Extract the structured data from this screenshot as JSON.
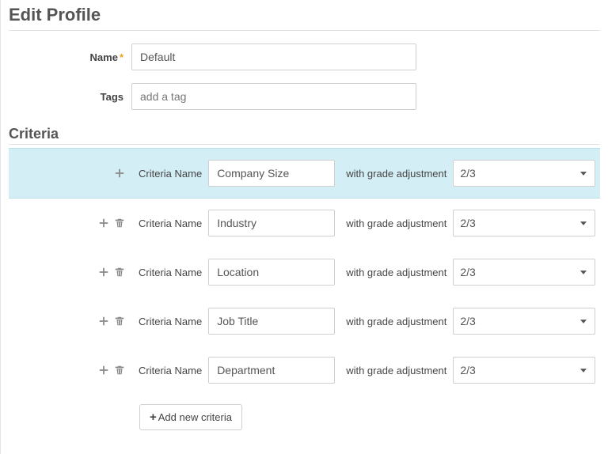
{
  "page": {
    "title": "Edit Profile",
    "criteria_section": "Criteria"
  },
  "form": {
    "name_label": "Name",
    "name_value": "Default",
    "tags_label": "Tags",
    "tags_placeholder": "add a tag"
  },
  "criteria_row": {
    "name_label": "Criteria Name",
    "grade_label": "with grade adjustment"
  },
  "criteria": [
    {
      "name": "Company Size",
      "grade": "2/3",
      "highlight": true,
      "show_delete": false
    },
    {
      "name": "Industry",
      "grade": "2/3",
      "highlight": false,
      "show_delete": true
    },
    {
      "name": "Location",
      "grade": "2/3",
      "highlight": false,
      "show_delete": true
    },
    {
      "name": "Job Title",
      "grade": "2/3",
      "highlight": false,
      "show_delete": true
    },
    {
      "name": "Department",
      "grade": "2/3",
      "highlight": false,
      "show_delete": true
    }
  ],
  "add_button_label": "Add new criteria"
}
